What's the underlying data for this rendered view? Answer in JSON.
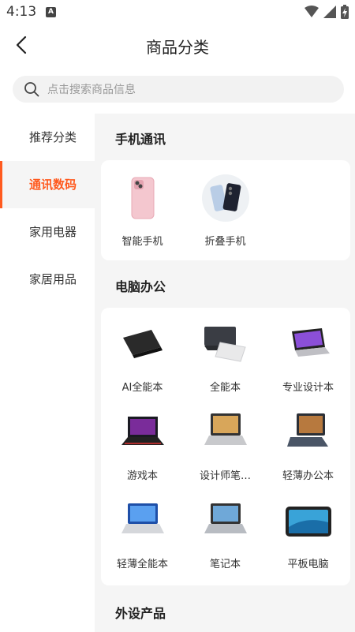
{
  "status_bar": {
    "time": "4:13",
    "notification_letter": "A"
  },
  "header": {
    "title": "商品分类"
  },
  "search": {
    "placeholder": "点击搜索商品信息"
  },
  "sidebar": {
    "items": [
      {
        "label": "推荐分类",
        "active": false
      },
      {
        "label": "通讯数码",
        "active": true
      },
      {
        "label": "家用电器",
        "active": false
      },
      {
        "label": "家居用品",
        "active": false
      }
    ]
  },
  "sections": [
    {
      "title": "手机通讯",
      "items": [
        {
          "label": "智能手机",
          "icon": "smartphone-icon"
        },
        {
          "label": "折叠手机",
          "icon": "foldable-phone-icon"
        }
      ]
    },
    {
      "title": "电脑办公",
      "items": [
        {
          "label": "AI全能本",
          "icon": "ai-laptop-icon"
        },
        {
          "label": "全能本",
          "icon": "all-in-one-laptop-icon"
        },
        {
          "label": "专业设计本",
          "icon": "design-laptop-icon"
        },
        {
          "label": "游戏本",
          "icon": "gaming-laptop-icon"
        },
        {
          "label": "设计师笔…",
          "icon": "designer-laptop-icon"
        },
        {
          "label": "轻薄办公本",
          "icon": "office-laptop-icon"
        },
        {
          "label": "轻薄全能本",
          "icon": "thin-laptop-icon"
        },
        {
          "label": "笔记本",
          "icon": "notebook-icon"
        },
        {
          "label": "平板电脑",
          "icon": "tablet-icon"
        }
      ]
    },
    {
      "title": "外设产品",
      "items": []
    }
  ],
  "colors": {
    "accent": "#ff5a1f",
    "background": "#f5f5f5",
    "card": "#ffffff"
  }
}
